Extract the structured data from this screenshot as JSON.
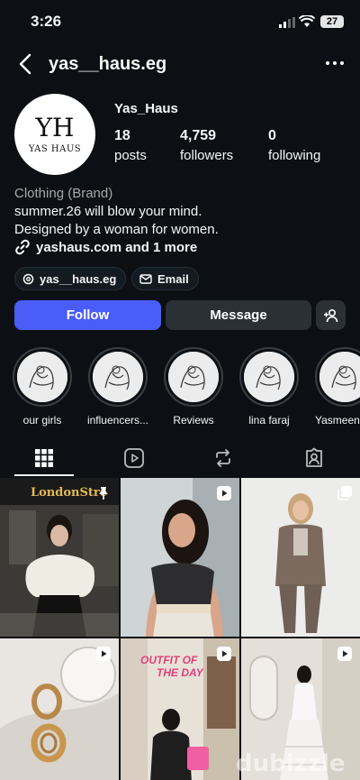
{
  "status": {
    "time": "3:26",
    "battery": "27"
  },
  "header": {
    "username": "yas__haus.eg"
  },
  "profile": {
    "avatar_monogram": "YH",
    "avatar_brand": "YAS HAUS",
    "display_name": "Yas_Haus",
    "stats": [
      {
        "value": "18",
        "label": "posts"
      },
      {
        "value": "4,759",
        "label": "followers"
      },
      {
        "value": "0",
        "label": "following"
      }
    ],
    "category": "Clothing (Brand)",
    "bio_line1": "summer.26 will blow your mind.",
    "bio_line2": "Designed by a woman for women.",
    "link": "yashaus.com and 1 more",
    "threads_chip": "yas__haus.eg",
    "email_chip": "Email"
  },
  "actions": {
    "follow": "Follow",
    "message": "Message"
  },
  "highlights": [
    {
      "label": "our girls"
    },
    {
      "label": "influencers..."
    },
    {
      "label": "Reviews"
    },
    {
      "label": "lina faraj"
    },
    {
      "label": "Yasmeen"
    }
  ],
  "posts": [
    {
      "sign_text": "LondonStre",
      "type": "pinned"
    },
    {
      "type": "reel"
    },
    {
      "type": "carousel"
    },
    {
      "type": "reel"
    },
    {
      "overlay_text1": "OUTFIT OF",
      "overlay_text2": "THE DAY",
      "type": "reel"
    },
    {
      "type": "reel"
    }
  ],
  "watermark": "dubizzle",
  "colors": {
    "background": "#0c1014",
    "follow_button": "#4a5df9",
    "secondary_button": "#2b3035"
  }
}
